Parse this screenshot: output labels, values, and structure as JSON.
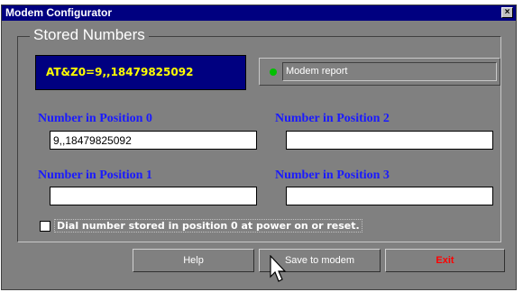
{
  "window": {
    "title": "Modem Configurator",
    "close_glyph": "×"
  },
  "group": {
    "legend": "Stored Numbers"
  },
  "at_display": {
    "text": "AT&Z0=9,,18479825092"
  },
  "report": {
    "status_icon": "green-led-icon",
    "status_color": "#00c000",
    "text": "Modem report"
  },
  "fields": {
    "position0": {
      "label": "Number in Position 0",
      "value": "9,,18479825092"
    },
    "position1": {
      "label": "Number in Position 1",
      "value": ""
    },
    "position2": {
      "label": "Number in Position 2",
      "value": ""
    },
    "position3": {
      "label": "Number in Position 3",
      "value": ""
    }
  },
  "dial_option": {
    "label": "Dial number stored in position 0 at power on or reset.",
    "checked": false
  },
  "buttons": {
    "help": "Help",
    "save": "Save to modem",
    "exit": "Exit"
  },
  "colors": {
    "window_bg": "#808080",
    "title_bar": "#000080",
    "display_bg": "#000080",
    "display_text": "#ffff00",
    "label_text": "#1a1aff",
    "exit_text": "#ff0000"
  }
}
